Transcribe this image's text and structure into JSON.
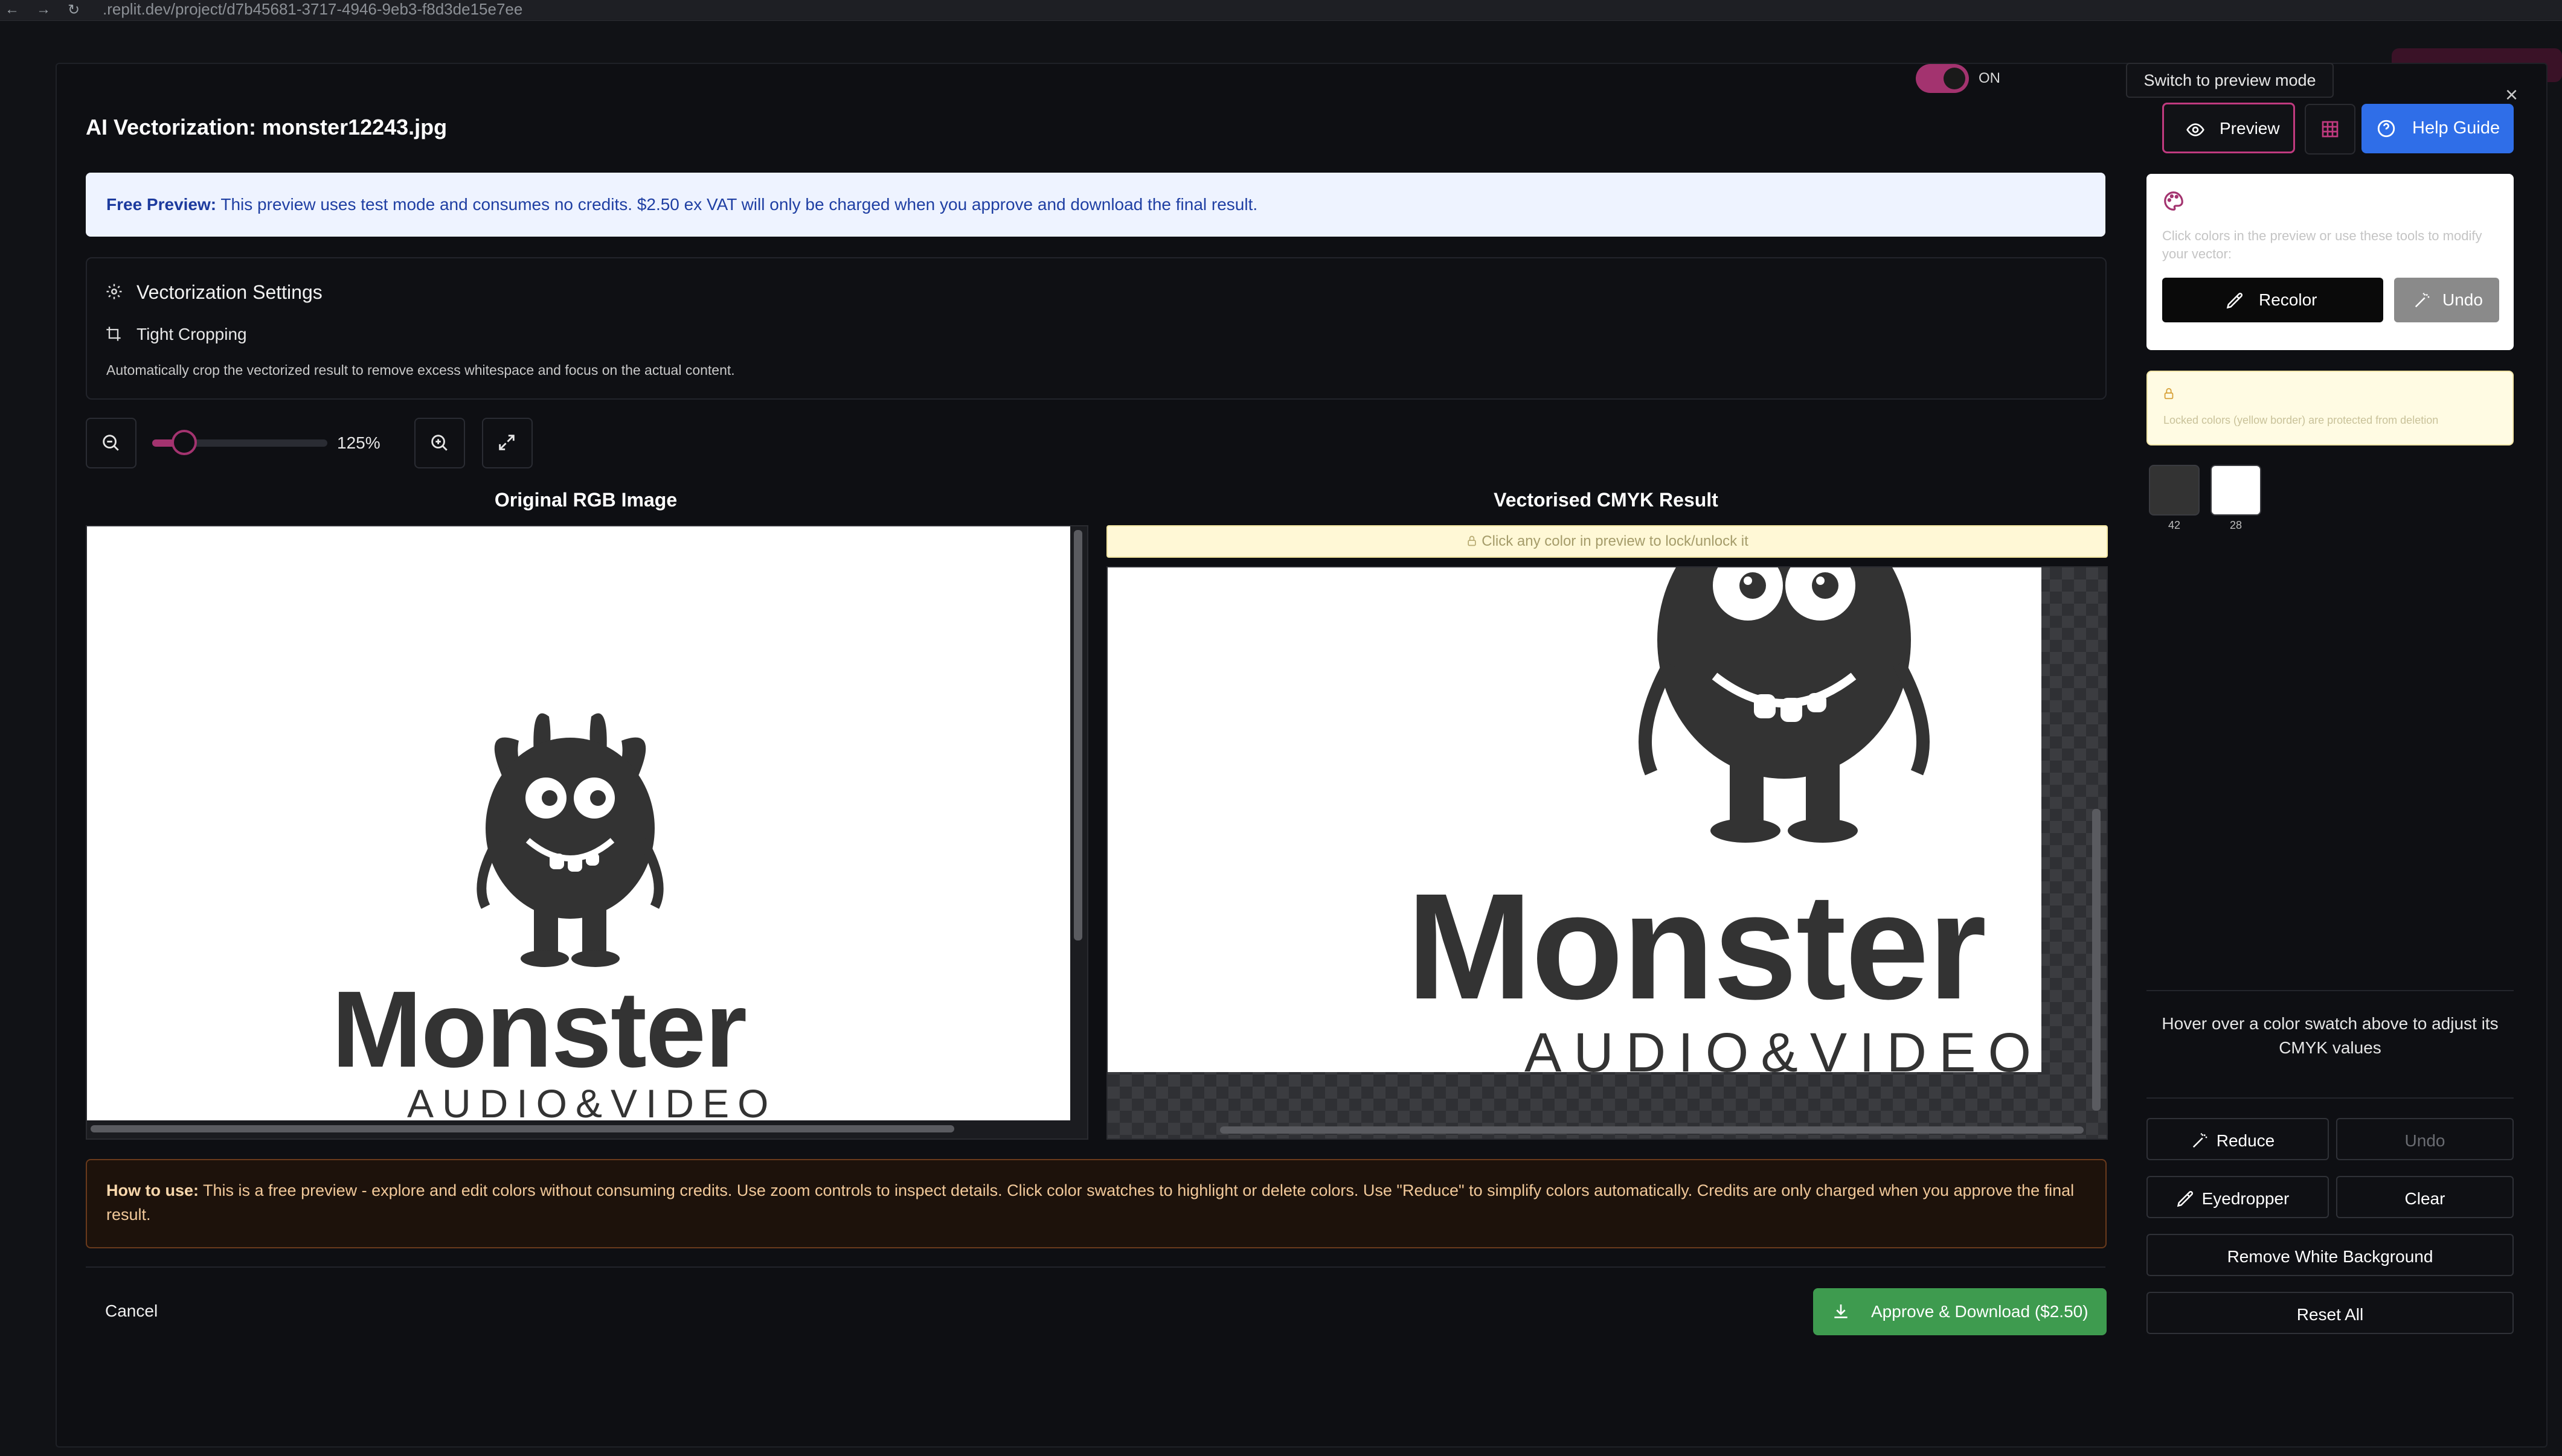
{
  "browser": {
    "url": ".replit.dev/project/d7b45681-3717-4946-9eb3-f8d3de15e7ee",
    "back_glyph": "←",
    "forward_glyph": "→",
    "reload_glyph": "↻"
  },
  "modal": {
    "title": "AI Vectorization: monster12243.jpg",
    "close_glyph": "×"
  },
  "free_preview": {
    "label": "Free Preview:",
    "text": " This preview uses test mode and consumes no credits. $2.50 ex VAT will only be charged when you approve and download the final result."
  },
  "settings": {
    "heading": "Vectorization Settings",
    "tight_cropping_label": "Tight Cropping",
    "tight_cropping_desc": "Automatically crop the vectorized result to remove excess whitespace and focus on the actual content.",
    "toggle_state": "ON",
    "toggle_on": true
  },
  "zoom": {
    "value_label": "125%",
    "level_percent": 125
  },
  "original": {
    "heading": "Original RGB Image",
    "logo_word": "Monster",
    "logo_sub": "AUDIO&VIDEO"
  },
  "vectorised": {
    "heading": "Vectorised CMYK Result",
    "lock_hint": "Click any color in preview to lock/unlock it",
    "logo_word": "Monster",
    "logo_sub": "AUDIO&VIDEO"
  },
  "howto": {
    "label": "How to use:",
    "text": " This is a free preview - explore and edit colors without consuming credits. Use zoom controls to inspect details. Click color swatches to highlight or delete colors. Use \"Reduce\" to simplify colors automatically. Credits are only charged when you approve the final result."
  },
  "footer": {
    "cancel_label": "Cancel",
    "approve_label": "Approve & Download ($2.50)"
  },
  "right_panel": {
    "tooltip": "Switch to preview mode",
    "preview_label": "Preview",
    "help_label": "Help Guide",
    "color_tools_hint": "Click colors in the preview or use these tools to modify your vector:",
    "recolor_label": "Recolor",
    "undo_top_label": "Undo",
    "locked_hint": "Locked colors (yellow border) are protected from deletion",
    "swatches": [
      {
        "color": "#333333",
        "count": "42"
      },
      {
        "color": "#ffffff",
        "count": "28"
      }
    ],
    "hover_hint": "Hover over a color swatch above to adjust its CMYK values",
    "reduce_label": "Reduce",
    "undo_label": "Undo",
    "eyedropper_label": "Eyedropper",
    "clear_label": "Clear",
    "remove_white_label": "Remove White Background",
    "reset_all_label": "Reset All"
  },
  "colors": {
    "accent": "#a3336f",
    "help_blue": "#2f6ee8",
    "approve_green": "#3e9b4f",
    "monster_fill": "#333333"
  }
}
